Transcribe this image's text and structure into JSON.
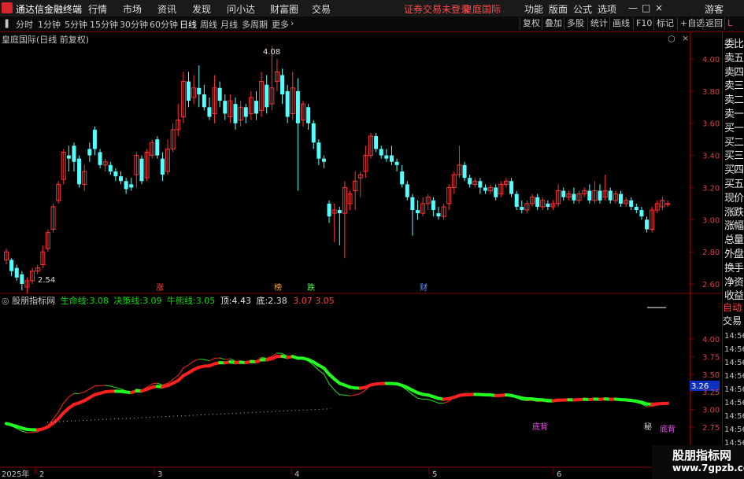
{
  "menu": {
    "app_title": "通达信金融终端",
    "items": [
      "行情",
      "市场",
      "资讯",
      "发现",
      "问小达",
      "财富圈",
      "交易"
    ],
    "notice": "证券交易未登录",
    "stock_link": "皇庭国际",
    "right_items": [
      "功能",
      "版面",
      "公式",
      "选项"
    ],
    "guest": "游客",
    "window_controls": [
      "—",
      "□",
      "×"
    ]
  },
  "toolbar": {
    "periods": [
      "分时",
      "1分钟",
      "5分钟",
      "15分钟",
      "30分钟",
      "60分钟",
      "日线",
      "周线",
      "月线",
      "多周期",
      "更多"
    ],
    "active": "日线",
    "right_buttons": [
      "复权",
      "叠加",
      "多股",
      "统计",
      "画线",
      "F10",
      "标记",
      "+自选",
      "返回"
    ]
  },
  "chart_header": "皇庭国际(日线 前复权)",
  "price_axis": [
    "4.00",
    "3.80",
    "3.60",
    "3.40",
    "3.20",
    "3.00",
    "2.80",
    "2.60"
  ],
  "high_label": "4.08",
  "low_label": "2.54",
  "event_labels": [
    "涨",
    "榜",
    "跌",
    "财"
  ],
  "indicator": {
    "name": "股朋指标网",
    "items": [
      {
        "label": "生命线:",
        "value": "3.08",
        "color": "#00e000"
      },
      {
        "label": "决策线:",
        "value": "3.09",
        "color": "#00e000"
      },
      {
        "label": "牛熊线:",
        "value": "3.05",
        "color": "#00e000"
      },
      {
        "label": "顶:",
        "value": "4.43",
        "color": "#e0e0e0"
      },
      {
        "label": "底:",
        "value": "2.38",
        "color": "#e0e0e0"
      }
    ],
    "extra": "3.07  3.05",
    "axis": [
      "4.00",
      "3.75",
      "3.50",
      "3.25",
      "3.00",
      "2.75"
    ],
    "current_value": "3.26",
    "signals": [
      "底背",
      "底背"
    ],
    "pin_label": "秘"
  },
  "date_axis": [
    "2025年",
    "2",
    "3",
    "4",
    "5",
    "6"
  ],
  "quote_panel": {
    "labels": [
      "委比",
      "卖五",
      "卖四",
      "卖三",
      "卖二",
      "卖一",
      "买一",
      "买二",
      "买三",
      "买四",
      "买五",
      "现价",
      "涨跌",
      "涨幅",
      "总量",
      "外盘",
      "换手",
      "净资",
      "收益"
    ],
    "auto_trade": [
      "自动",
      "交易"
    ],
    "times": [
      "14:56",
      "14:56",
      "14:56",
      "14:56",
      "14:56",
      "14:56",
      "14:56",
      "14:56",
      "14:56",
      "14:56"
    ]
  },
  "watermark": {
    "title": "股朋指标网",
    "url": "www.7gpzb.com"
  },
  "chart_data": {
    "type": "candlestick",
    "title": "皇庭国际(日线 前复权)",
    "ylim": [
      2.5,
      4.15
    ],
    "candles": [
      [
        2.75,
        2.8,
        2.72,
        2.82
      ],
      [
        2.75,
        2.68,
        2.65,
        2.76
      ],
      [
        2.7,
        2.64,
        2.62,
        2.72
      ],
      [
        2.66,
        2.6,
        2.56,
        2.68
      ],
      [
        2.58,
        2.62,
        2.54,
        2.64
      ],
      [
        2.62,
        2.68,
        2.6,
        2.7
      ],
      [
        2.68,
        2.7,
        2.66,
        2.72
      ],
      [
        2.72,
        2.8,
        2.7,
        2.84
      ],
      [
        2.82,
        2.92,
        2.8,
        2.94
      ],
      [
        2.94,
        3.08,
        2.92,
        3.1
      ],
      [
        3.12,
        3.22,
        3.1,
        3.24
      ],
      [
        3.25,
        3.42,
        3.22,
        3.44
      ],
      [
        3.4,
        3.38,
        3.3,
        3.46
      ],
      [
        3.46,
        3.36,
        3.3,
        3.48
      ],
      [
        3.38,
        3.22,
        3.2,
        3.4
      ],
      [
        3.22,
        3.3,
        3.18,
        3.34
      ],
      [
        3.44,
        3.4,
        3.36,
        3.48
      ],
      [
        3.56,
        3.44,
        3.4,
        3.58
      ],
      [
        3.42,
        3.34,
        3.32,
        3.44
      ],
      [
        3.34,
        3.36,
        3.3,
        3.38
      ],
      [
        3.34,
        3.3,
        3.28,
        3.36
      ],
      [
        3.3,
        3.27,
        3.24,
        3.32
      ],
      [
        3.27,
        3.24,
        3.22,
        3.3
      ],
      [
        3.24,
        3.19,
        3.16,
        3.26
      ],
      [
        3.22,
        3.2,
        3.18,
        3.26
      ],
      [
        3.28,
        3.4,
        3.2,
        3.42
      ],
      [
        3.38,
        3.24,
        3.22,
        3.4
      ],
      [
        3.26,
        3.42,
        3.24,
        3.44
      ],
      [
        3.4,
        3.48,
        3.38,
        3.5
      ],
      [
        3.5,
        3.4,
        3.38,
        3.52
      ],
      [
        3.38,
        3.28,
        3.24,
        3.42
      ],
      [
        3.3,
        3.44,
        3.28,
        3.5
      ],
      [
        3.44,
        3.56,
        3.42,
        3.6
      ],
      [
        3.56,
        3.62,
        3.52,
        3.72
      ],
      [
        3.64,
        3.86,
        3.6,
        3.92
      ],
      [
        3.86,
        3.74,
        3.7,
        3.92
      ],
      [
        3.76,
        3.82,
        3.72,
        3.9
      ],
      [
        3.82,
        3.78,
        3.7,
        3.96
      ],
      [
        3.78,
        3.7,
        3.68,
        3.84
      ],
      [
        3.7,
        3.64,
        3.62,
        3.76
      ],
      [
        3.66,
        3.82,
        3.6,
        3.9
      ],
      [
        3.82,
        3.74,
        3.7,
        3.86
      ],
      [
        3.74,
        3.66,
        3.62,
        3.78
      ],
      [
        3.64,
        3.74,
        3.6,
        3.78
      ],
      [
        3.72,
        3.6,
        3.56,
        3.76
      ],
      [
        3.62,
        3.7,
        3.58,
        3.74
      ],
      [
        3.7,
        3.64,
        3.6,
        3.72
      ],
      [
        3.66,
        3.76,
        3.62,
        3.8
      ],
      [
        3.74,
        3.66,
        3.62,
        3.8
      ],
      [
        3.68,
        3.86,
        3.64,
        3.92
      ],
      [
        3.84,
        3.7,
        3.66,
        3.9
      ],
      [
        3.72,
        3.82,
        3.68,
        4.08
      ],
      [
        3.86,
        3.92,
        3.8,
        4.0
      ],
      [
        3.9,
        3.78,
        3.72,
        3.94
      ],
      [
        3.8,
        3.64,
        3.6,
        3.84
      ],
      [
        3.66,
        3.82,
        3.62,
        3.92
      ],
      [
        3.8,
        3.6,
        3.18,
        3.88
      ],
      [
        3.62,
        3.72,
        3.58,
        3.74
      ],
      [
        3.7,
        3.6,
        3.56,
        3.72
      ],
      [
        3.6,
        3.48,
        3.44,
        3.62
      ],
      [
        3.48,
        3.38,
        3.34,
        3.5
      ],
      [
        3.38,
        3.36,
        3.32,
        3.4
      ],
      [
        3.1,
        3.02,
        2.98,
        3.12
      ],
      [
        3.04,
        3.06,
        2.86,
        3.1
      ],
      [
        3.06,
        3.04,
        2.84,
        3.08
      ],
      [
        3.04,
        3.2,
        2.76,
        3.24
      ],
      [
        3.1,
        3.16,
        3.06,
        3.18
      ],
      [
        3.18,
        3.24,
        3.06,
        3.3
      ],
      [
        3.26,
        3.28,
        3.14,
        3.3
      ],
      [
        3.3,
        3.4,
        3.26,
        3.46
      ],
      [
        3.4,
        3.52,
        3.38,
        3.54
      ],
      [
        3.52,
        3.44,
        3.42,
        3.54
      ],
      [
        3.44,
        3.4,
        3.38,
        3.46
      ],
      [
        3.4,
        3.38,
        3.36,
        3.44
      ],
      [
        3.4,
        3.36,
        3.34,
        3.46
      ],
      [
        3.36,
        3.34,
        3.3,
        3.38
      ],
      [
        3.3,
        3.22,
        3.2,
        3.34
      ],
      [
        3.22,
        3.14,
        3.12,
        3.24
      ],
      [
        3.14,
        3.06,
        2.9,
        3.16
      ],
      [
        3.06,
        3.04,
        3.0,
        3.12
      ],
      [
        3.04,
        3.1,
        3.02,
        3.14
      ],
      [
        3.1,
        3.14,
        3.06,
        3.16
      ],
      [
        3.12,
        3.06,
        3.02,
        3.14
      ],
      [
        3.04,
        3.02,
        3.0,
        3.08
      ],
      [
        3.02,
        3.08,
        3.0,
        3.1
      ],
      [
        3.1,
        3.2,
        3.06,
        3.22
      ],
      [
        3.2,
        3.28,
        3.16,
        3.3
      ],
      [
        3.28,
        3.34,
        3.26,
        3.46
      ],
      [
        3.34,
        3.26,
        3.24,
        3.36
      ],
      [
        3.26,
        3.22,
        3.2,
        3.28
      ],
      [
        3.22,
        3.24,
        3.2,
        3.26
      ],
      [
        3.24,
        3.2,
        3.16,
        3.26
      ],
      [
        3.2,
        3.18,
        3.16,
        3.22
      ],
      [
        3.18,
        3.2,
        3.16,
        3.22
      ],
      [
        3.2,
        3.14,
        3.12,
        3.22
      ],
      [
        3.16,
        3.22,
        3.14,
        3.24
      ],
      [
        3.22,
        3.24,
        3.2,
        3.26
      ],
      [
        3.24,
        3.16,
        3.14,
        3.26
      ],
      [
        3.16,
        3.08,
        3.06,
        3.18
      ],
      [
        3.08,
        3.06,
        3.04,
        3.12
      ],
      [
        3.06,
        3.1,
        3.04,
        3.12
      ],
      [
        3.1,
        3.14,
        3.08,
        3.16
      ],
      [
        3.14,
        3.08,
        3.06,
        3.16
      ],
      [
        3.08,
        3.12,
        3.06,
        3.14
      ],
      [
        3.1,
        3.08,
        3.06,
        3.12
      ],
      [
        3.08,
        3.1,
        3.06,
        3.12
      ],
      [
        3.1,
        3.18,
        3.08,
        3.22
      ],
      [
        3.18,
        3.14,
        3.12,
        3.2
      ],
      [
        3.14,
        3.16,
        3.12,
        3.18
      ],
      [
        3.16,
        3.12,
        3.1,
        3.2
      ],
      [
        3.12,
        3.16,
        3.1,
        3.18
      ],
      [
        3.16,
        3.18,
        3.14,
        3.2
      ],
      [
        3.18,
        3.12,
        3.1,
        3.22
      ],
      [
        3.12,
        3.18,
        3.1,
        3.24
      ],
      [
        3.18,
        3.12,
        3.1,
        3.22
      ],
      [
        3.14,
        3.18,
        3.12,
        3.28
      ],
      [
        3.18,
        3.12,
        3.1,
        3.2
      ],
      [
        3.12,
        3.16,
        3.1,
        3.18
      ],
      [
        3.16,
        3.1,
        3.08,
        3.18
      ],
      [
        3.1,
        3.12,
        3.08,
        3.14
      ],
      [
        3.12,
        3.08,
        3.06,
        3.14
      ],
      [
        3.08,
        3.06,
        3.04,
        3.1
      ],
      [
        3.06,
        3.02,
        3.0,
        3.08
      ],
      [
        3.0,
        2.94,
        2.92,
        3.02
      ],
      [
        2.94,
        3.06,
        2.92,
        3.08
      ],
      [
        3.06,
        3.1,
        3.04,
        3.12
      ],
      [
        3.08,
        3.12,
        3.06,
        3.14
      ],
      [
        3.1,
        3.1,
        3.08,
        3.12
      ]
    ]
  }
}
